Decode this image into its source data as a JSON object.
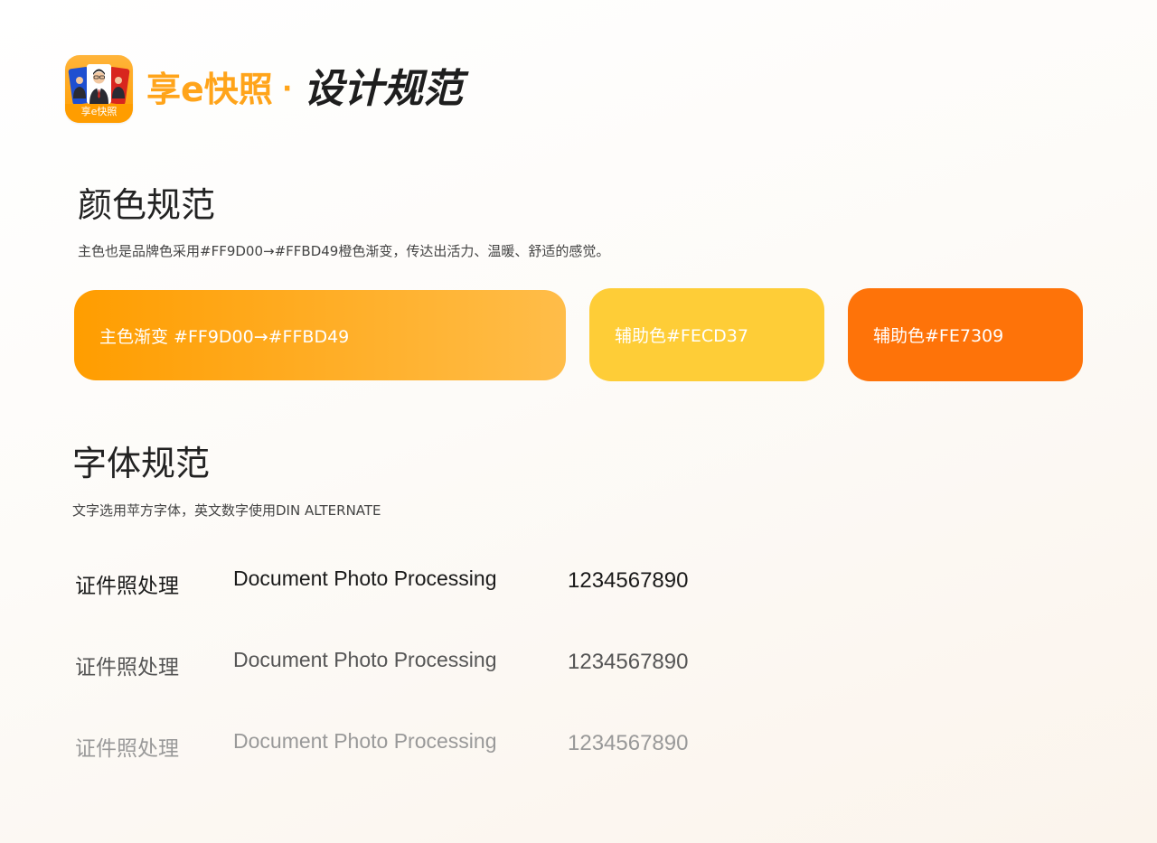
{
  "header": {
    "app_icon_label": "享e快照",
    "brand": "享e快照",
    "separator": "·",
    "title": "设计规范"
  },
  "color_section": {
    "heading": "颜色规范",
    "description": "主色也是品牌色采用#FF9D00→#FFBD49橙色渐变，传达出活力、温暖、舒适的感觉。",
    "swatches": [
      {
        "label": "主色渐变 #FF9D00→#FFBD49",
        "color_from": "#FF9D00",
        "color_to": "#FFBD49"
      },
      {
        "label": "辅助色#FECD37",
        "color": "#FECD37"
      },
      {
        "label": "辅助色#FE7309",
        "color": "#FE7309"
      }
    ]
  },
  "font_section": {
    "heading": "字体规范",
    "description": "文字选用苹方字体，英文数字使用DIN ALTERNATE",
    "samples": [
      {
        "cn": "证件照处理",
        "en": "Document Photo Processing",
        "num": "1234567890",
        "color": "#1a1a1a"
      },
      {
        "cn": "证件照处理",
        "en": "Document Photo Processing",
        "num": "1234567890",
        "color": "#555555"
      },
      {
        "cn": "证件照处理",
        "en": "Document Photo Processing",
        "num": "1234567890",
        "color": "#999999"
      }
    ]
  },
  "colors": {
    "brand_orange": "#FFA41A",
    "text_dark": "#222222"
  }
}
